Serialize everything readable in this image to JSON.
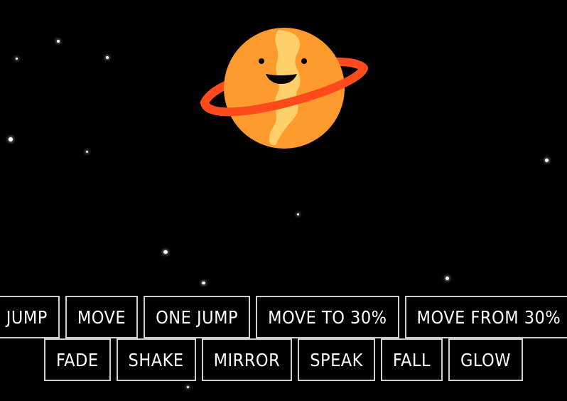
{
  "scene": {
    "background": "#000000",
    "stars_color": "#ffffff"
  },
  "planet": {
    "name": "planet-character",
    "body_color": "#ff9a2e",
    "stripe_color": "#ffd06a",
    "ring_color": "#ff4a1c",
    "face_color": "#000000"
  },
  "controls": {
    "row1": [
      {
        "id": "jump",
        "label": "JUMP"
      },
      {
        "id": "move",
        "label": "MOVE"
      },
      {
        "id": "one-jump",
        "label": "ONE JUMP"
      },
      {
        "id": "move-to-30",
        "label": "MOVE TO 30%"
      },
      {
        "id": "move-from-30",
        "label": "MOVE FROM 30%"
      }
    ],
    "row2": [
      {
        "id": "fade",
        "label": "FADE"
      },
      {
        "id": "shake",
        "label": "SHAKE"
      },
      {
        "id": "mirror",
        "label": "MIRROR"
      },
      {
        "id": "speak",
        "label": "SPEAK"
      },
      {
        "id": "fall",
        "label": "FALL"
      },
      {
        "id": "glow",
        "label": "GLOW"
      }
    ]
  }
}
